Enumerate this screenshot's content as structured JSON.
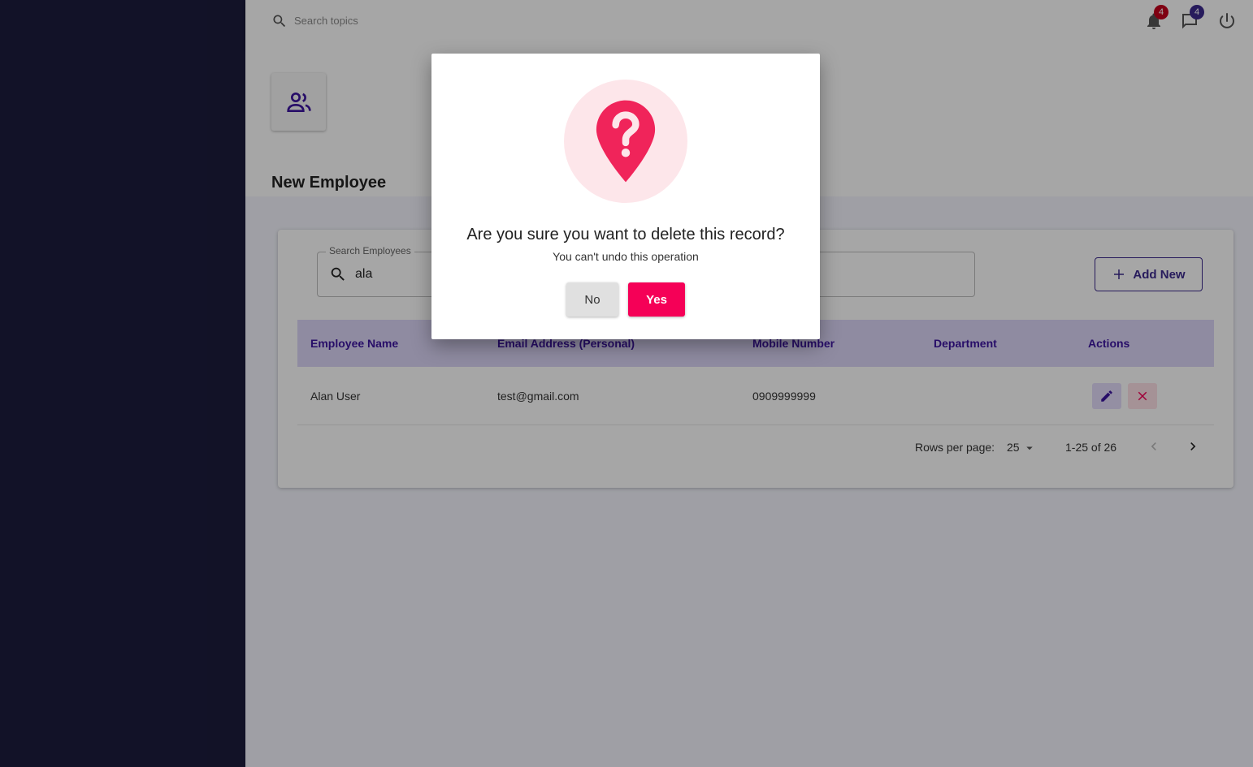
{
  "topbar": {
    "search_placeholder": "Search topics",
    "notifications_count": "4",
    "messages_count": "4"
  },
  "page": {
    "icon": "people-icon",
    "title": "New Employee"
  },
  "employees": {
    "search_label": "Search Employees",
    "search_value": "ala",
    "add_label": "Add New",
    "columns": [
      "Employee Name",
      "Email Address (Personal)",
      "Mobile Number",
      "Department",
      "Actions"
    ],
    "rows": [
      {
        "name": "Alan User",
        "email": "test@gmail.com",
        "mobile": "0909999999",
        "department": ""
      }
    ],
    "pagination": {
      "rows_per_page_label": "Rows per page:",
      "rows_per_page": "25",
      "range": "1-25 of 26"
    }
  },
  "dialog": {
    "icon": "question-pin-icon",
    "title": "Are you sure you want to delete this record?",
    "subtitle": "You can't undo this operation",
    "no_label": "No",
    "yes_label": "Yes"
  },
  "colors": {
    "sidebar": "#1c1c3d",
    "accent": "#3c2a8e",
    "danger": "#f50057",
    "header_row": "#dcd6f7"
  }
}
